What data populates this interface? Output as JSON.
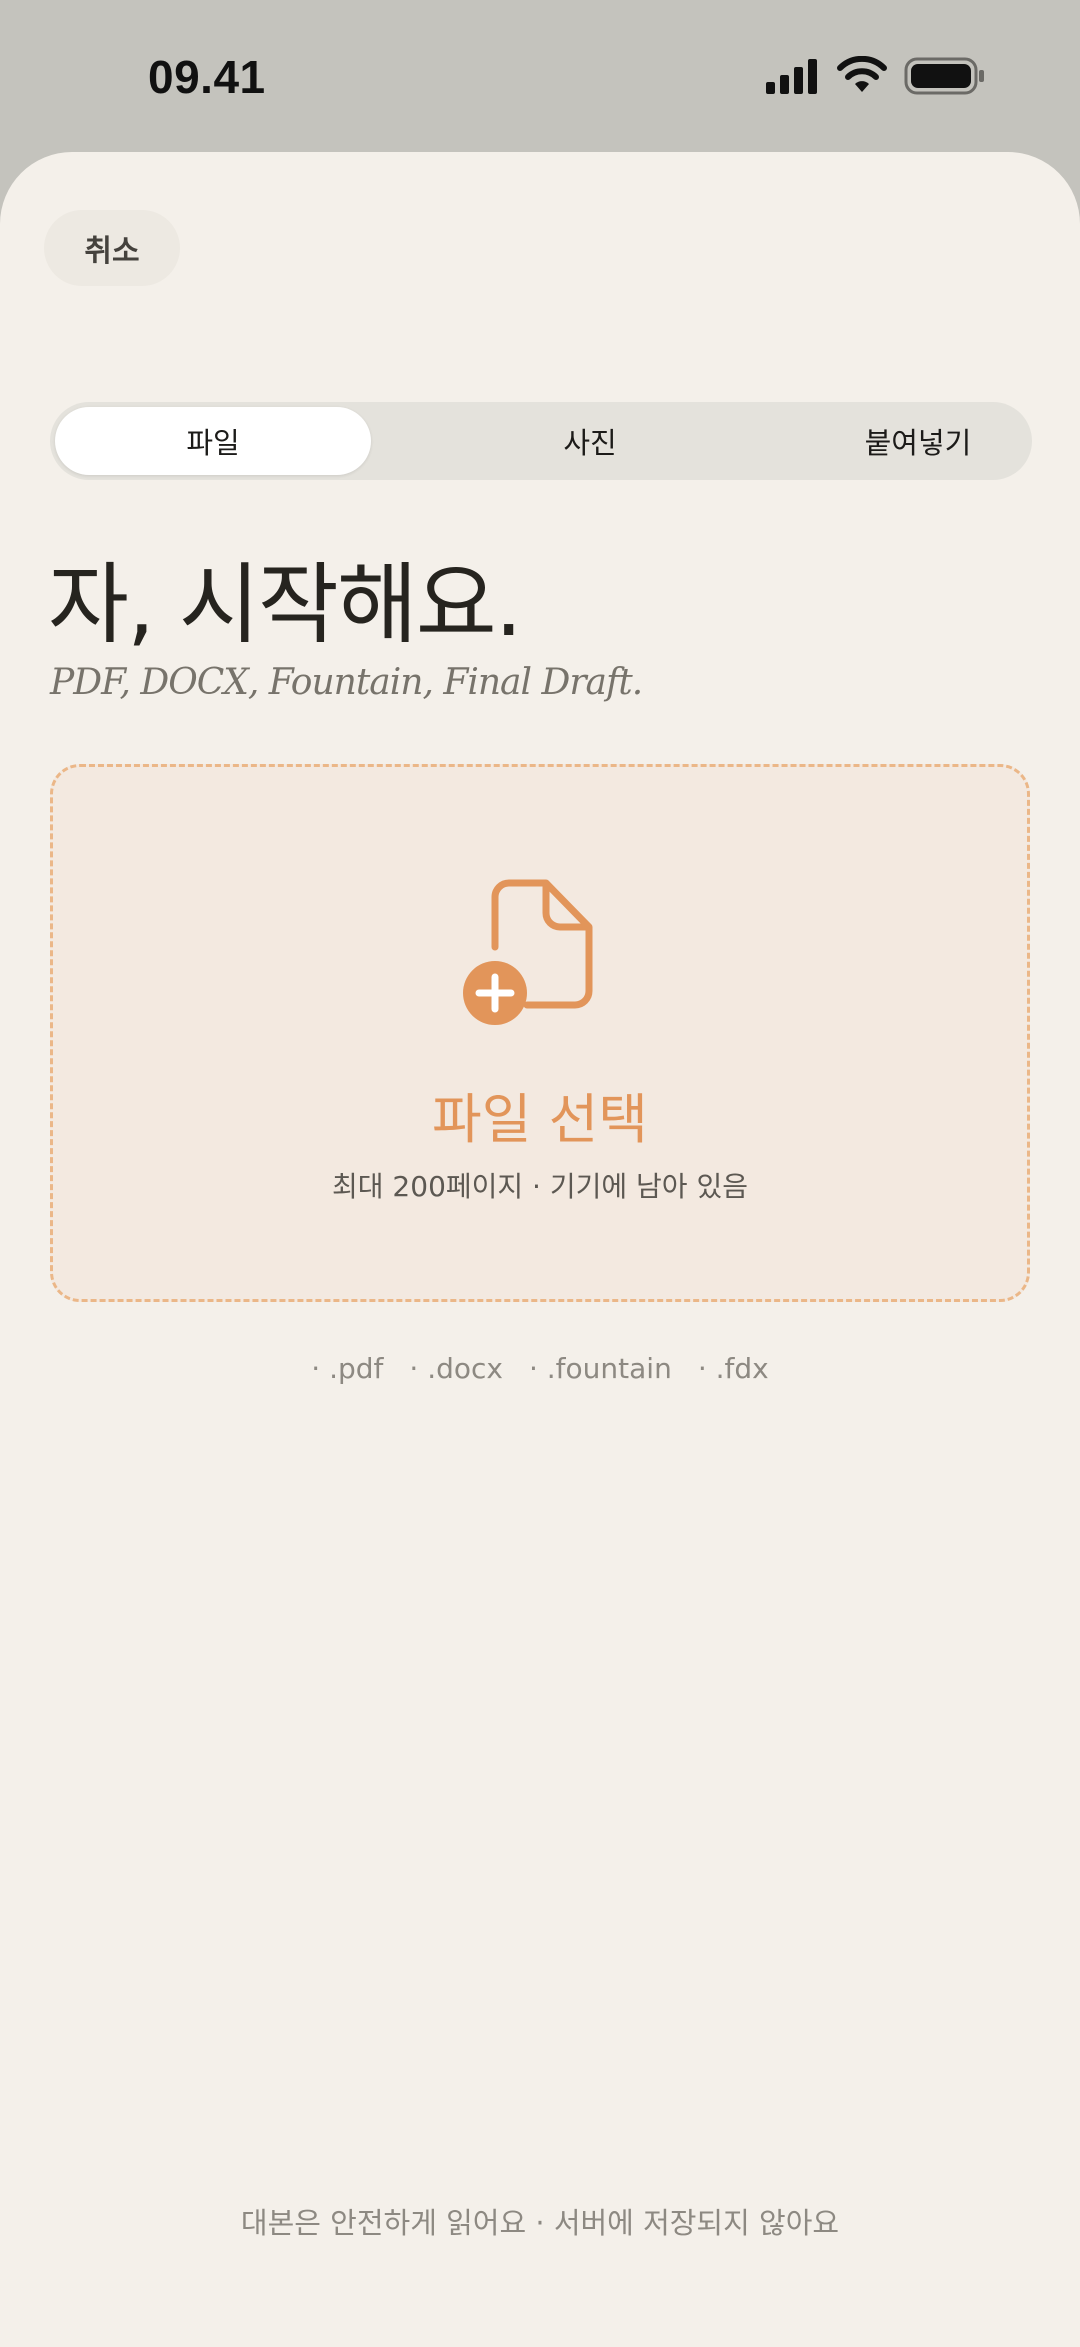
{
  "status_bar": {
    "time": "09.41",
    "icons": [
      "cellular-signal-icon",
      "wifi-icon",
      "battery-icon"
    ]
  },
  "header": {
    "cancel_label": "취소"
  },
  "tabs": [
    {
      "label": "파일",
      "active": true
    },
    {
      "label": "사진",
      "active": false
    },
    {
      "label": "붙여넣기",
      "active": false
    }
  ],
  "main": {
    "title": "자, 시작해요.",
    "subtitle": "PDF, DOCX, Fountain, Final Draft."
  },
  "dropzone": {
    "icon": "file-add-icon",
    "title": "파일 선택",
    "caption": "최대 200페이지 · 기기에 남아 있음"
  },
  "formats": [
    "· .pdf",
    "· .docx",
    "· .fountain",
    "· .fdx"
  ],
  "footer": {
    "note": "대본은 안전하게 읽어요 · 서버에 저장되지 않아요"
  },
  "colors": {
    "background": "#f4f0ea",
    "accent": "#e2955a",
    "dropzone_fill": "#f3e9e0",
    "dropzone_border": "#ebb788",
    "status_bar": "#c4c3bd"
  }
}
